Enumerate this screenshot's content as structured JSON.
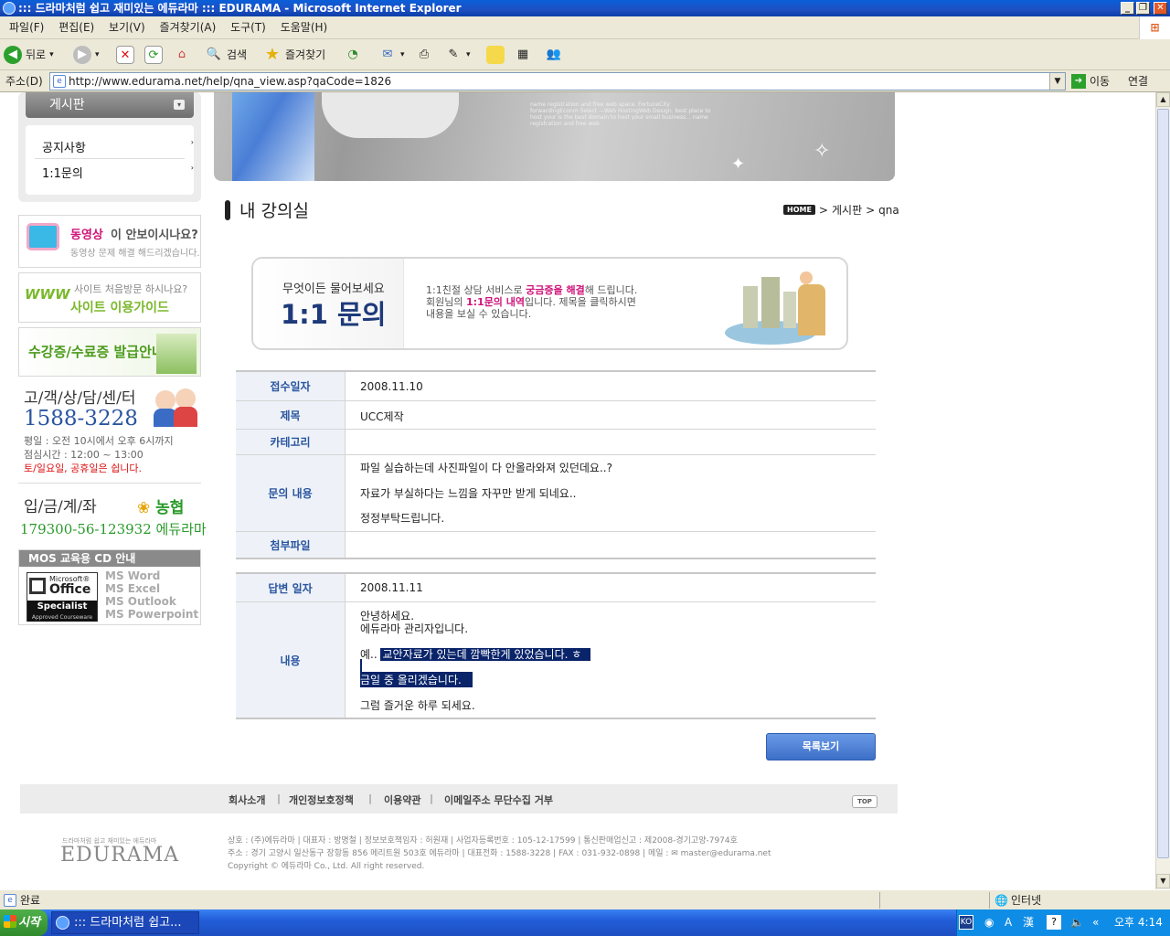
{
  "window": {
    "title": "::: 드라마처럼 쉽고 재미있는 에듀라마 ::: EDURAMA - Microsoft Internet Explorer"
  },
  "menu": [
    "파일(F)",
    "편집(E)",
    "보기(V)",
    "즐겨찾기(A)",
    "도구(T)",
    "도움말(H)"
  ],
  "toolbar": {
    "back": "뒤로",
    "search": "검색",
    "favorites": "즐겨찾기"
  },
  "address": {
    "label": "주소(D)",
    "url": "http://www.edurama.net/help/qna_view.asp?qaCode=1826",
    "go": "이동",
    "links": "연결"
  },
  "sidebar": {
    "menu_title": "게시판",
    "items": [
      "공지사항",
      "1:1문의"
    ],
    "banner_video": {
      "highlight": "동영상",
      "title_rest": "이 안보이시나요?",
      "sub": "동영상 문제 해결 해드리겠습니다."
    },
    "banner_guide": {
      "sub": "사이트 처음방문 하시나요?",
      "title": "사이트 이용가이드"
    },
    "banner_cert": {
      "title": "수강증/수료증 발급안내"
    },
    "support": {
      "title": "고/객/상/담/센/터",
      "phone": "1588-3228",
      "hours": "평일 : 오전 10시에서 오후 6시까지",
      "lunch": "점심시간 : 12:00 ~ 13:00",
      "holiday": "토/일요일, 공휴일은 쉽니다."
    },
    "bank": {
      "title": "입/금/계/좌",
      "bank_name": "농협",
      "account": "179300-56-123932 에듀라마"
    },
    "mos": {
      "title": "MOS 교육용 CD 안내",
      "logo_top": "Microsoft®",
      "logo_mid": "Office",
      "logo_spec": "Specialist",
      "logo_bottom": "Approved Courseware",
      "items": [
        "MS Word",
        "MS Excel",
        "MS Outlook",
        "MS Powerpoint"
      ]
    }
  },
  "content": {
    "page_title": "내 강의실",
    "breadcrumb": {
      "home": "HOME",
      "path1": "게시판",
      "path2": "qna"
    },
    "hero_text": "name registration and free web space. FortuneCity forwardingEconm Select —Web HostingWeb Design. best place to host your is the best domain to host your small business... name registration and free web",
    "intro": {
      "small": "무엇이든 물어보세요",
      "big": "1:1 문의",
      "line1_a": "1:1친절 상담 서비스로 ",
      "line1_b": "궁금증을 해결",
      "line1_c": "해 드립니다.",
      "line2_a": "회원님의 ",
      "line2_b": "1:1문의 내역",
      "line2_c": "입니다. 제목을 클릭하시면",
      "line3": "내용을 보실 수 있습니다."
    },
    "question": {
      "date_label": "접수일자",
      "date": "2008.11.10",
      "subject_label": "제목",
      "subject": "UCC제작",
      "category_label": "카테고리",
      "category": "",
      "body_label": "문의 내용",
      "body": [
        "파일 실습하는데 사진파일이 다 안올라와져 있던데요..?",
        "자료가 부실하다는 느낌을 자꾸만 받게 되네요..",
        "정정부탁드립니다."
      ],
      "attach_label": "첨부파일",
      "attach": ""
    },
    "answer": {
      "date_label": "답변 일자",
      "date": "2008.11.11",
      "body_label": "내용",
      "line1": "안녕하세요.",
      "line2": "에듀라마 관리자입니다.",
      "line3_a": "예.. ",
      "line3_b": "교안자료가 있는데 깜빡한게 있었습니다. ㅎ",
      "line4": "금일 중 올리겠습니다.",
      "line5": "그럼 즐거운 하루 되세요."
    },
    "list_button": "목록보기"
  },
  "footer": {
    "nav": [
      "회사소개",
      "개인정보호정책",
      "이용약관",
      "이메일주소 무단수집 거부"
    ],
    "top": "TOP",
    "logo_tag": "드라마처럼 쉽고 재미있는 에듀라마",
    "logo": "EDURAMA",
    "info1": "상호 : (주)에듀라마 | 대표자 : 방명철 | 정보보호책임자 : 허원재 | 사업자등록번호 : 105-12-17599 | 통신판매업신고 : 제2008-경기고양-7974호",
    "info2": "주소 : 경기 고양시 일산동구 장항동 856 메리트원 503호 에듀라마 | 대표전화 : 1588-3228 | FAX : 031-932-0898 | 메일 : ✉ master@edurama.net",
    "copy": "Copyright © 에듀라마 Co., Ltd. All right reserved."
  },
  "status": {
    "text": "완료",
    "zone": "인터넷"
  },
  "taskbar": {
    "start": "시작",
    "item": "::: 드라마처럼 쉽고...",
    "time": "오후 4:14",
    "ime": "漢"
  },
  "colors": {
    "accent_blue": "#2a55a0",
    "pink": "#d0147a",
    "label_bg": "#eef2f8",
    "button": "#4a7ed6"
  }
}
